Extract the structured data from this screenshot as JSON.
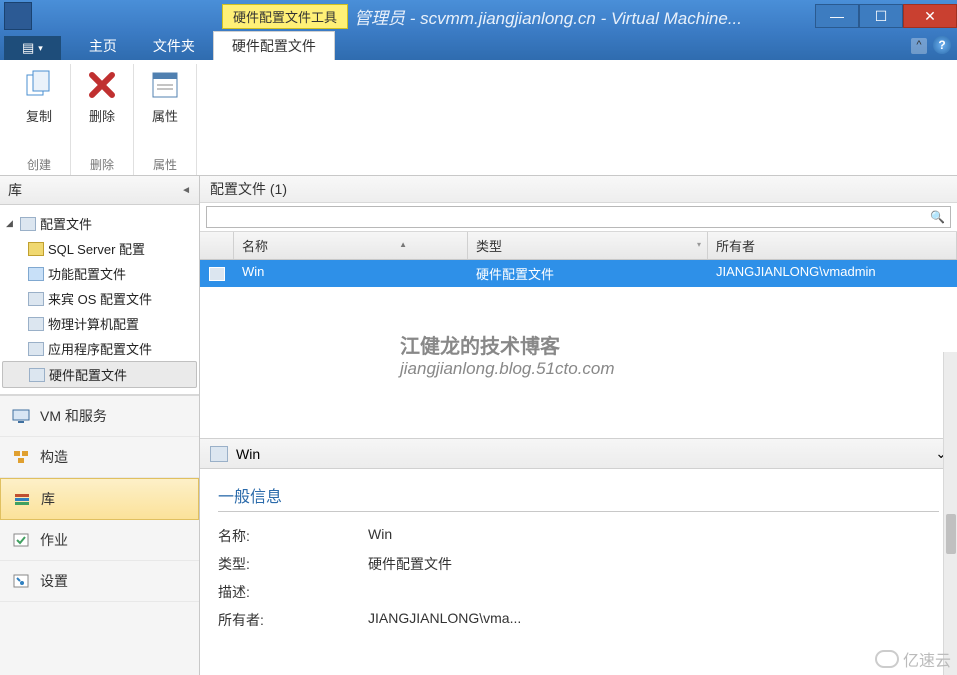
{
  "window": {
    "contextual_tab_group": "硬件配置文件工具",
    "title": "管理员 - scvmm.jiangjianlong.cn - Virtual Machine..."
  },
  "ribbon": {
    "file_menu_icon": "▤",
    "tabs": [
      "主页",
      "文件夹",
      "硬件配置文件"
    ],
    "active_tab_index": 2,
    "groups": [
      {
        "label": "创建",
        "buttons": [
          {
            "label": "复制",
            "icon": "copy"
          }
        ]
      },
      {
        "label": "删除",
        "buttons": [
          {
            "label": "删除",
            "icon": "delete"
          }
        ]
      },
      {
        "label": "属性",
        "buttons": [
          {
            "label": "属性",
            "icon": "properties"
          }
        ]
      }
    ]
  },
  "sidebar": {
    "header": "库",
    "tree": {
      "root": {
        "label": "配置文件",
        "expanded": true
      },
      "children": [
        {
          "label": "SQL Server 配置",
          "icon": "sql"
        },
        {
          "label": "功能配置文件",
          "icon": "cloud"
        },
        {
          "label": "来宾 OS 配置文件",
          "icon": "generic"
        },
        {
          "label": "物理计算机配置",
          "icon": "generic"
        },
        {
          "label": "应用程序配置文件",
          "icon": "generic"
        },
        {
          "label": "硬件配置文件",
          "icon": "generic",
          "selected": true
        }
      ]
    },
    "nav": [
      {
        "label": "VM 和服务",
        "icon": "vm"
      },
      {
        "label": "构造",
        "icon": "fabric"
      },
      {
        "label": "库",
        "icon": "library",
        "active": true
      },
      {
        "label": "作业",
        "icon": "jobs"
      },
      {
        "label": "设置",
        "icon": "settings"
      }
    ]
  },
  "content": {
    "header": "配置文件 (1)",
    "search_placeholder": "",
    "columns": [
      "",
      "名称",
      "类型",
      "所有者"
    ],
    "rows": [
      {
        "name": "Win",
        "type": "硬件配置文件",
        "owner": "JIANGJIANLONG\\vmadmin"
      }
    ]
  },
  "detail": {
    "title": "Win",
    "section_title": "一般信息",
    "fields": [
      {
        "label": "名称:",
        "value": "Win"
      },
      {
        "label": "类型:",
        "value": "硬件配置文件"
      },
      {
        "label": "描述:",
        "value": ""
      },
      {
        "label": "所有者:",
        "value": "JIANGJIANLONG\\vma..."
      }
    ]
  },
  "watermark": {
    "line1": "江健龙的技术博客",
    "line2": "jiangjianlong.blog.51cto.com"
  },
  "brand": "亿速云"
}
